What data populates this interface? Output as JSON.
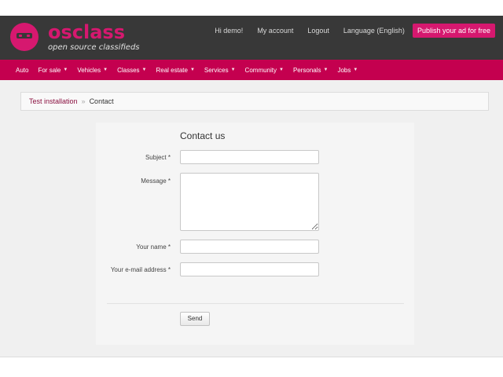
{
  "brand": {
    "wordmark": "osclass",
    "tagline": "open source classifieds",
    "accent_color": "#d6186f"
  },
  "user_nav": {
    "greeting": "Hi demo!",
    "my_account": "My account",
    "logout": "Logout",
    "language": "Language (English)",
    "publish_button": "Publish your ad for free"
  },
  "categories": [
    {
      "label": "Auto",
      "has_dropdown": false
    },
    {
      "label": "For sale",
      "has_dropdown": true
    },
    {
      "label": "Vehicles",
      "has_dropdown": true
    },
    {
      "label": "Classes",
      "has_dropdown": true
    },
    {
      "label": "Real estate",
      "has_dropdown": true
    },
    {
      "label": "Services",
      "has_dropdown": true
    },
    {
      "label": "Community",
      "has_dropdown": true
    },
    {
      "label": "Personals",
      "has_dropdown": true
    },
    {
      "label": "Jobs",
      "has_dropdown": true
    }
  ],
  "caret_glyph": "▼",
  "breadcrumb": {
    "home": "Test installation",
    "separator": "»",
    "current": "Contact"
  },
  "contact_form": {
    "title": "Contact us",
    "subject_label": "Subject *",
    "subject_value": "",
    "message_label": "Message *",
    "message_value": "",
    "name_label": "Your name *",
    "name_value": "",
    "email_label": "Your e-mail address *",
    "email_value": "",
    "send_button": "Send"
  }
}
